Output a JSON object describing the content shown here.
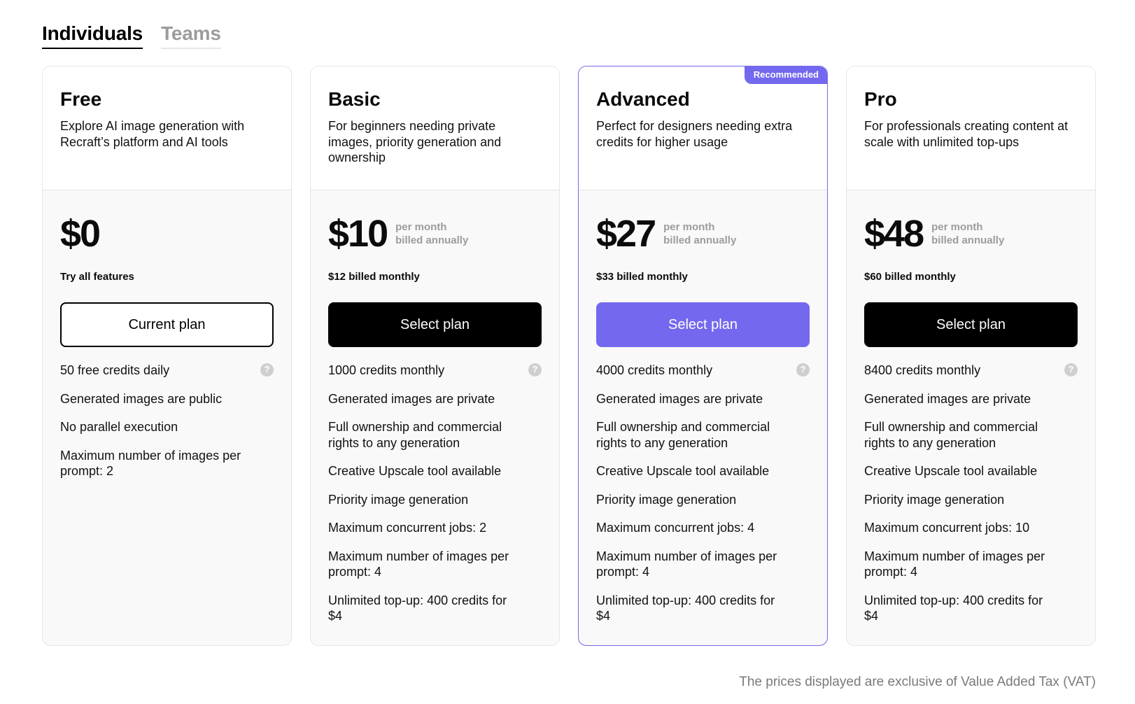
{
  "tabs": [
    {
      "label": "Individuals",
      "active": true
    },
    {
      "label": "Teams",
      "active": false
    }
  ],
  "accent_color": "#7468ee",
  "plans": [
    {
      "name": "Free",
      "description": "Explore AI image generation with Recraft’s platform and AI tools",
      "price": "$0",
      "price_note_1": "",
      "price_note_2": "",
      "billed_text": "Try all features",
      "button_label": "Current plan",
      "button_style": "current",
      "recommended": false,
      "features": [
        {
          "text": "50 free credits daily",
          "help_icon": "question-circle-icon"
        },
        {
          "text": "Generated images are public"
        },
        {
          "text": "No parallel execution"
        },
        {
          "text": "Maximum number of images per prompt: 2"
        }
      ]
    },
    {
      "name": "Basic",
      "description": "For beginners needing private images, priority generation and ownership",
      "price": "$10",
      "price_note_1": "per month",
      "price_note_2": "billed annually",
      "billed_text": "$12 billed monthly",
      "button_label": "Select plan",
      "button_style": "dark",
      "recommended": false,
      "features": [
        {
          "text": "1000 credits monthly",
          "help_icon": "question-circle-icon"
        },
        {
          "text": "Generated images are private"
        },
        {
          "text": "Full ownership and commercial rights to any generation"
        },
        {
          "text": "Creative Upscale tool available"
        },
        {
          "text": "Priority image generation"
        },
        {
          "text": "Maximum concurrent jobs: 2"
        },
        {
          "text": "Maximum number of images per prompt: 4"
        },
        {
          "text": "Unlimited top-up: 400 credits for $4"
        }
      ]
    },
    {
      "name": "Advanced",
      "description": "Perfect for designers needing extra credits for higher usage",
      "price": "$27",
      "price_note_1": "per month",
      "price_note_2": "billed annually",
      "billed_text": "$33 billed monthly",
      "button_label": "Select plan",
      "button_style": "accent",
      "recommended": true,
      "badge_label": "Recommended",
      "features": [
        {
          "text": "4000 credits monthly",
          "help_icon": "question-circle-icon"
        },
        {
          "text": "Generated images are private"
        },
        {
          "text": "Full ownership and commercial rights to any generation"
        },
        {
          "text": "Creative Upscale tool available"
        },
        {
          "text": "Priority image generation"
        },
        {
          "text": "Maximum concurrent jobs: 4"
        },
        {
          "text": "Maximum number of images per prompt: 4"
        },
        {
          "text": "Unlimited top-up: 400 credits for $4"
        }
      ]
    },
    {
      "name": "Pro",
      "description": "For professionals creating content at scale with unlimited top-ups",
      "price": "$48",
      "price_note_1": "per month",
      "price_note_2": "billed annually",
      "billed_text": "$60 billed monthly",
      "button_label": "Select plan",
      "button_style": "dark",
      "recommended": false,
      "features": [
        {
          "text": "8400 credits monthly",
          "help_icon": "question-circle-icon"
        },
        {
          "text": "Generated images are private"
        },
        {
          "text": "Full ownership and commercial rights to any generation"
        },
        {
          "text": "Creative Upscale tool available"
        },
        {
          "text": "Priority image generation"
        },
        {
          "text": "Maximum concurrent jobs: 10"
        },
        {
          "text": "Maximum number of images per prompt: 4"
        },
        {
          "text": "Unlimited top-up: 400 credits for $4"
        }
      ]
    }
  ],
  "help_glyph": "?",
  "vat_note": "The prices displayed are exclusive of Value Added Tax (VAT)"
}
